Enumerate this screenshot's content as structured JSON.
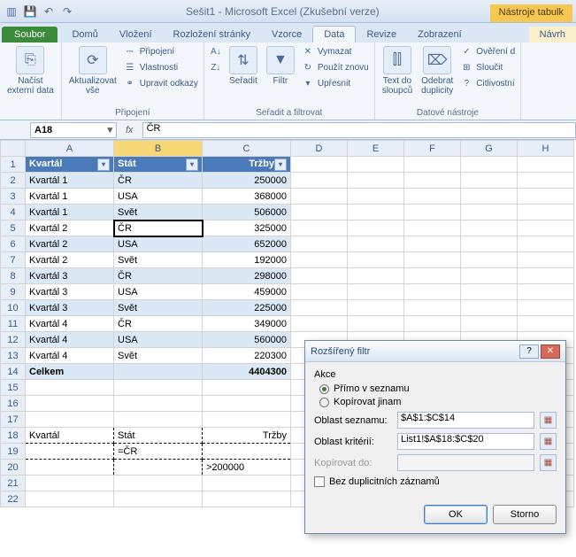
{
  "title": "Sešit1 - Microsoft Excel (Zkušební verze)",
  "context_tab": "Nástroje tabulk",
  "tabs": {
    "file": "Soubor",
    "home": "Domů",
    "insert": "Vložení",
    "layout": "Rozložení stránky",
    "formulas": "Vzorce",
    "data": "Data",
    "review": "Revize",
    "view": "Zobrazení",
    "design": "Návrh"
  },
  "ribbon": {
    "external": "Načíst\nexterní data",
    "refresh": "Aktualizovat\nvše",
    "conn1": "Připojení",
    "conn2": "Vlastnosti",
    "conn3": "Upravit odkazy",
    "group_conn": "Připojení",
    "sort": "Seřadit",
    "filter": "Filtr",
    "clear": "Vymazat",
    "reapply": "Použít znovu",
    "advanced": "Upřesnit",
    "group_sort": "Seřadit a filtrovat",
    "t2c": "Text do\nsloupců",
    "dup": "Odebrat\nduplicity",
    "valid": "Ověření d",
    "consol": "Sloučit",
    "whatif": "Citlivostní",
    "group_tools": "Datové nástroje"
  },
  "namebox": "A18",
  "formula": "ČR",
  "cols": [
    "A",
    "B",
    "C",
    "D",
    "E",
    "F",
    "G",
    "H"
  ],
  "headers": {
    "q": "Kvartál",
    "s": "Stát",
    "t": "Tržby"
  },
  "rows": [
    {
      "q": "Kvartál 1",
      "s": "ČR",
      "t": "250000"
    },
    {
      "q": "Kvartál 1",
      "s": "USA",
      "t": "368000"
    },
    {
      "q": "Kvartál 1",
      "s": "Svět",
      "t": "506000"
    },
    {
      "q": "Kvartál 2",
      "s": "ČR",
      "t": "325000"
    },
    {
      "q": "Kvartál 2",
      "s": "USA",
      "t": "652000"
    },
    {
      "q": "Kvartál 2",
      "s": "Svět",
      "t": "192000"
    },
    {
      "q": "Kvartál 3",
      "s": "ČR",
      "t": "298000"
    },
    {
      "q": "Kvartál 3",
      "s": "USA",
      "t": "459000"
    },
    {
      "q": "Kvartál 3",
      "s": "Svět",
      "t": "225000"
    },
    {
      "q": "Kvartál 4",
      "s": "ČR",
      "t": "349000"
    },
    {
      "q": "Kvartál 4",
      "s": "USA",
      "t": "560000"
    },
    {
      "q": "Kvartál 4",
      "s": "Svět",
      "t": "220300"
    }
  ],
  "total_label": "Celkem",
  "total_value": "4404300",
  "criteria": {
    "h_q": "Kvartál",
    "h_s": "Stát",
    "h_t": "Tržby",
    "r19_s": "=ČR",
    "r20_t": ">200000"
  },
  "dialog": {
    "title": "Rozšířený filtr",
    "action_label": "Akce",
    "opt_inplace": "Přímo v seznamu",
    "opt_copy": "Kopírovat jinam",
    "list_label": "Oblast seznamu:",
    "list_value": "$A$1:$C$14",
    "crit_label": "Oblast kritérií:",
    "crit_value": "List1!$A$18:$C$20",
    "copy_label": "Kopírovat do:",
    "copy_value": "",
    "unique": "Bez duplicitních záznamů",
    "ok": "OK",
    "cancel": "Storno"
  },
  "chart_data": {
    "type": "table",
    "columns": [
      "Kvartál",
      "Stát",
      "Tržby"
    ],
    "rows": [
      [
        "Kvartál 1",
        "ČR",
        250000
      ],
      [
        "Kvartál 1",
        "USA",
        368000
      ],
      [
        "Kvartál 1",
        "Svět",
        506000
      ],
      [
        "Kvartál 2",
        "ČR",
        325000
      ],
      [
        "Kvartál 2",
        "USA",
        652000
      ],
      [
        "Kvartál 2",
        "Svět",
        192000
      ],
      [
        "Kvartál 3",
        "ČR",
        298000
      ],
      [
        "Kvartál 3",
        "USA",
        459000
      ],
      [
        "Kvartál 3",
        "Svět",
        225000
      ],
      [
        "Kvartál 4",
        "ČR",
        349000
      ],
      [
        "Kvartál 4",
        "USA",
        560000
      ],
      [
        "Kvartál 4",
        "Svět",
        220300
      ]
    ],
    "total": 4404300
  }
}
